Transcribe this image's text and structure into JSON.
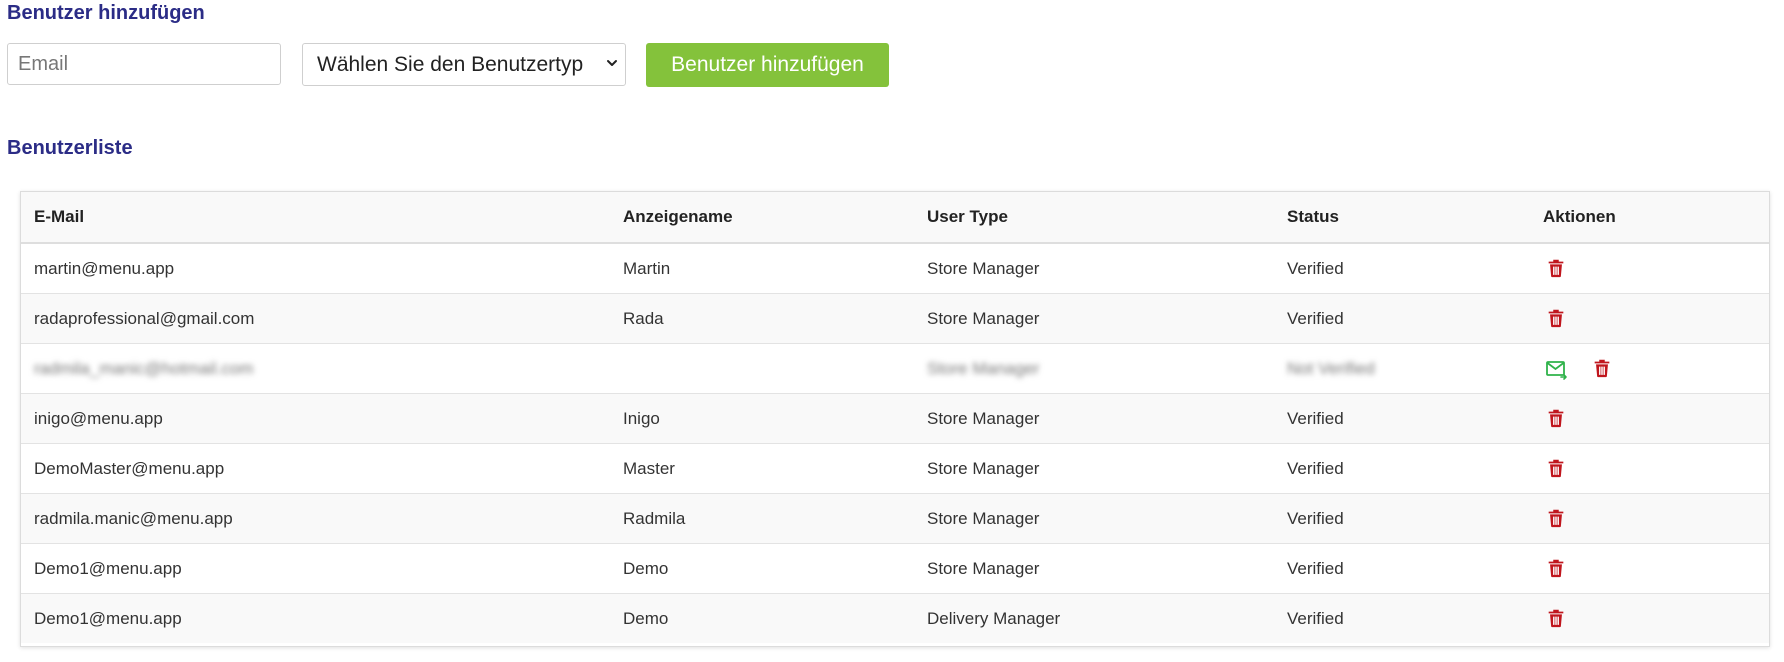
{
  "add_section": {
    "title": "Benutzer hinzufügen",
    "email_placeholder": "Email",
    "select_value": "Wählen Sie den Benutzertyp",
    "button_label": "Benutzer hinzufügen"
  },
  "list_section": {
    "title": "Benutzerliste"
  },
  "table": {
    "headers": [
      "E-Mail",
      "Anzeigename",
      "User Type",
      "Status",
      "Aktionen"
    ],
    "rows": [
      {
        "email": "martin@menu.app",
        "name": "Martin",
        "type": "Store Manager",
        "status": "Verified",
        "actions": [
          "delete-icon"
        ]
      },
      {
        "email": "radaprofessional@gmail.com",
        "name": "Rada",
        "type": "Store Manager",
        "status": "Verified",
        "actions": [
          "delete-icon"
        ]
      },
      {
        "email": "radmila_manic@hotmail.com",
        "name": "",
        "type": "Store Manager",
        "status": "Not Verified",
        "actions": [
          "resend-mail-icon",
          "delete-icon"
        ]
      },
      {
        "email": "inigo@menu.app",
        "name": "Inigo",
        "type": "Store Manager",
        "status": "Verified",
        "actions": [
          "delete-icon"
        ]
      },
      {
        "email": "DemoMaster@menu.app",
        "name": "Master",
        "type": "Store Manager",
        "status": "Verified",
        "actions": [
          "delete-icon"
        ]
      },
      {
        "email": "radmila.manic@menu.app",
        "name": "Radmila",
        "type": "Store Manager",
        "status": "Verified",
        "actions": [
          "delete-icon"
        ]
      },
      {
        "email": "Demo1@menu.app",
        "name": "Demo",
        "type": "Store Manager",
        "status": "Verified",
        "actions": [
          "delete-icon"
        ]
      },
      {
        "email": "Demo1@menu.app",
        "name": "Demo",
        "type": "Delivery Manager",
        "status": "Verified",
        "actions": [
          "delete-icon"
        ]
      }
    ]
  },
  "colors": {
    "title": "#2b2c86",
    "button": "#84c23b",
    "delete_icon": "#c0161d",
    "mail_icon": "#2fb24a"
  }
}
